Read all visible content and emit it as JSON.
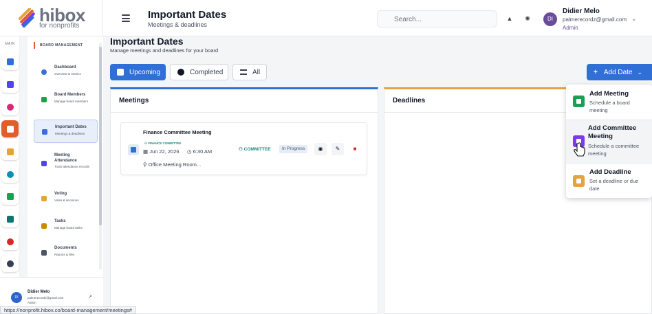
{
  "brand": {
    "name": "hibox",
    "tagline": "for nonprofits"
  },
  "header": {
    "title": "Important Dates",
    "subtitle": "Meetings & deadlines",
    "search_placeholder": "Search...",
    "user": {
      "initials": "DI",
      "name": "Didier Melo",
      "email": "palmerecordz@gmail.com",
      "role": "Admin"
    }
  },
  "rail": {
    "label": "MAIN",
    "items": [
      "home",
      "org-chart",
      "pill",
      "calendar",
      "badge",
      "circle",
      "share",
      "users",
      "chart",
      "gear"
    ]
  },
  "sidebar": {
    "section": "BOARD MANAGEMENT",
    "items": [
      {
        "label": "Dashboard",
        "desc": "Overview & metrics"
      },
      {
        "label": "Board Members",
        "desc": "Manage board members"
      },
      {
        "label": "Important Dates",
        "desc": "Meetings & deadlines"
      },
      {
        "label": "Meeting Attendance",
        "desc": "Track attendance records"
      },
      {
        "label": "Voting",
        "desc": "Votes & decisions"
      },
      {
        "label": "Tasks",
        "desc": "Manage board tasks"
      },
      {
        "label": "Documents",
        "desc": "Reports & files"
      }
    ],
    "footer": {
      "initials": "DI",
      "name": "Didier Melo",
      "email": "palmerecordz@gmail.com",
      "role": "Admin"
    }
  },
  "page": {
    "title": "Important Dates",
    "subtitle": "Manage meetings and deadlines for your board"
  },
  "filters": {
    "upcoming": "Upcoming",
    "completed": "Completed",
    "all": "All"
  },
  "add_date": {
    "label": "Add Date"
  },
  "panels": {
    "meetings": "Meetings",
    "deadlines": "Deadlines"
  },
  "meeting": {
    "title": "Finance Committee Meeting",
    "tag": "FINANCE COMMITTEE",
    "date": "Jun 22, 2026",
    "time": "6:30 AM",
    "location": "Office Meeting Room...",
    "type": "COMMITTEE",
    "status": "In Progress"
  },
  "menu": [
    {
      "title": "Add Meeting",
      "desc": "Schedule a board meeting",
      "color": "#1f9d55"
    },
    {
      "title": "Add Committee Meeting",
      "desc": "Schedule a committee meeting",
      "color": "#7c3aed"
    },
    {
      "title": "Add Deadline",
      "desc": "Set a deadline or due date",
      "color": "#e6a23c"
    }
  ],
  "status_url": "https://nonprofit.hibox.co/board-management/meetings#",
  "colors": {
    "primary": "#2f6fd6",
    "accent": "#e35d2a",
    "deadline": "#e6a23c"
  }
}
